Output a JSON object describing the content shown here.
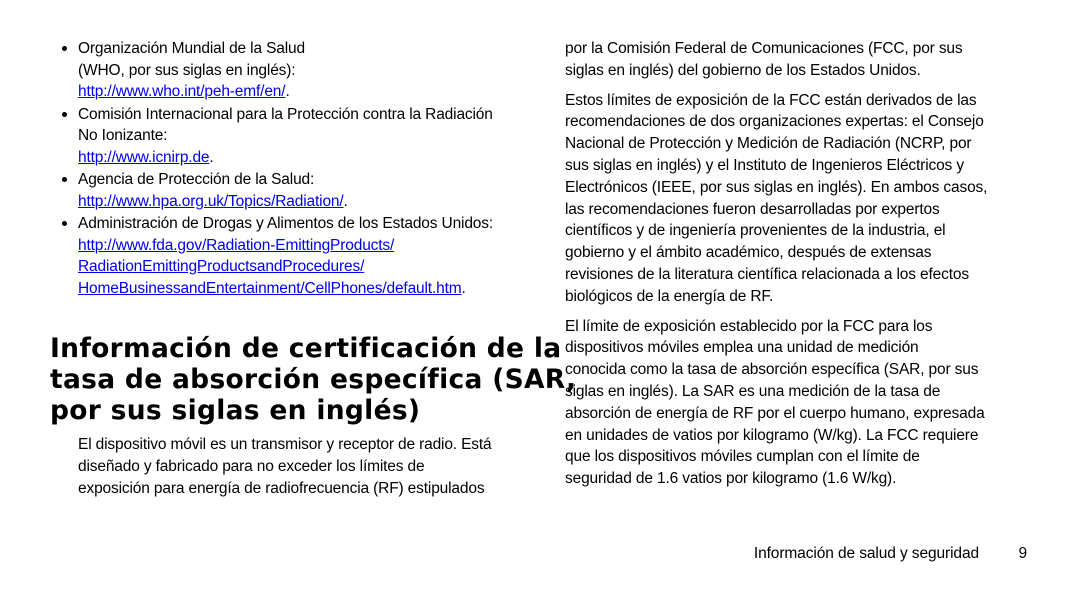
{
  "document": {
    "language": "es",
    "background_color": "#ffffff",
    "text_color": "#000000"
  },
  "left_column": {
    "bullets": [
      {
        "name": "who-bullet",
        "lines": [
          {
            "text": "Organización Mundial de la Salud",
            "is_url": false
          },
          {
            "text": "(WHO, por sus siglas en inglés):",
            "is_url": false
          },
          {
            "text": "http://www.who.int/peh-emf/en/",
            "is_url": true,
            "trailing": "."
          }
        ]
      },
      {
        "name": "icnirp-bullet",
        "lines": [
          {
            "text": "Comisión Internacional para la Protección contra la Radiación",
            "is_url": false
          },
          {
            "text": "No Ionizante:",
            "is_url": false
          },
          {
            "text": "http://www.icnirp.de",
            "is_url": true,
            "trailing": "."
          }
        ]
      },
      {
        "name": "hpa-bullet",
        "lines": [
          {
            "text": "Agencia de Protección de la Salud:",
            "is_url": false
          },
          {
            "text": "http://www.hpa.org.uk/Topics/Radiation/",
            "is_url": true,
            "trailing": "."
          }
        ]
      },
      {
        "name": "fda-bullet",
        "lines": [
          {
            "text": "Administración de Drogas y Alimentos de los Estados Unidos:",
            "is_url": false
          },
          {
            "text": "http://www.fda.gov/Radiation-EmittingProducts/",
            "is_url": true,
            "trailing": ""
          },
          {
            "text": "RadiationEmittingProductsandProcedures/",
            "is_url": true,
            "trailing": ""
          },
          {
            "text": "HomeBusinessandEntertainment/CellPhones/default.htm",
            "is_url": true,
            "trailing": "."
          }
        ]
      }
    ],
    "heading": {
      "full_text": "Información de certificación de la tasa de absorción específica (SAR, por sus siglas en inglés)",
      "lines": [
        "Información de certificación de la",
        "tasa de absorción específica (SAR,",
        "por sus siglas en inglés)"
      ]
    },
    "paragraph": {
      "full_text": "El dispositivo móvil es un transmisor y receptor de radio. Está diseñado y fabricado para no exceder los límites de exposición para energía de radiofrecuencia (RF) estipulados",
      "lines": [
        "El dispositivo móvil es un transmisor y receptor de radio. Está",
        "diseñado y fabricado para no exceder los límites de",
        "exposición para energía de radiofrecuencia (RF) estipulados"
      ]
    }
  },
  "right_column": {
    "paragraphs": [
      {
        "name": "fcc-continuation-paragraph",
        "full_text": "por la Comisión Federal de Comunicaciones (FCC, por sus siglas en inglés) del gobierno de los Estados Unidos.",
        "lines": [
          "por la Comisión Federal de Comunicaciones (FCC, por sus",
          "siglas en inglés) del gobierno de los Estados Unidos."
        ]
      },
      {
        "name": "fcc-limits-paragraph",
        "full_text": "Estos límites de exposición de la FCC están derivados de las recomendaciones de dos organizaciones expertas: el Consejo Nacional de Protección y Medición de Radiación (NCRP, por sus siglas en inglés) y el Instituto de Ingenieros Eléctricos y Electrónicos (IEEE, por sus siglas en inglés). En ambos casos, las recomendaciones fueron desarrolladas por expertos científicos y de ingeniería provenientes de la industria, el gobierno y el ámbito académico, después de extensas revisiones de la literatura científica relacionada a los efectos biológicos de la energía de RF.",
        "lines": [
          "Estos límites de exposición de la FCC están derivados de las",
          "recomendaciones de dos organizaciones expertas: el Consejo",
          "Nacional de Protección y Medición de Radiación (NCRP, por",
          "sus siglas en inglés) y el Instituto de Ingenieros Eléctricos y",
          "Electrónicos (IEEE, por sus siglas en inglés). En ambos casos,",
          "las recomendaciones fueron desarrolladas por expertos",
          "científicos y de ingeniería provenientes de la industria, el",
          "gobierno y el ámbito académico, después de extensas",
          "revisiones de la literatura científica relacionada a los efectos",
          "biológicos de la energía de RF."
        ]
      },
      {
        "name": "sar-definition-paragraph",
        "full_text": "El límite de exposición establecido por la FCC para los dispositivos móviles emplea una unidad de medición conocida como la tasa de absorción específica (SAR, por sus siglas en inglés). La SAR es una medición de la tasa de absorción de energía de RF por el cuerpo humano, expresada en unidades de vatios por kilogramo (W/kg). La FCC requiere que los dispositivos móviles cumplan con el límite de seguridad de 1.6 vatios por kilogramo (1.6 W/kg).",
        "lines": [
          "El límite de exposición establecido por la FCC para los",
          "dispositivos móviles emplea una unidad de medición",
          "conocida como la tasa de absorción específica (SAR, por sus",
          "siglas en inglés). La SAR es una medición de la tasa de",
          "absorción de energía de RF por el cuerpo humano, expresada",
          "en unidades de vatios por kilogramo (W/kg). La FCC requiere",
          "que los dispositivos móviles cumplan con el límite de",
          "seguridad de 1.6 vatios por kilogramo (1.6 W/kg)."
        ]
      }
    ]
  },
  "footer": {
    "title": "Información de salud y seguridad",
    "page_number": "9"
  }
}
